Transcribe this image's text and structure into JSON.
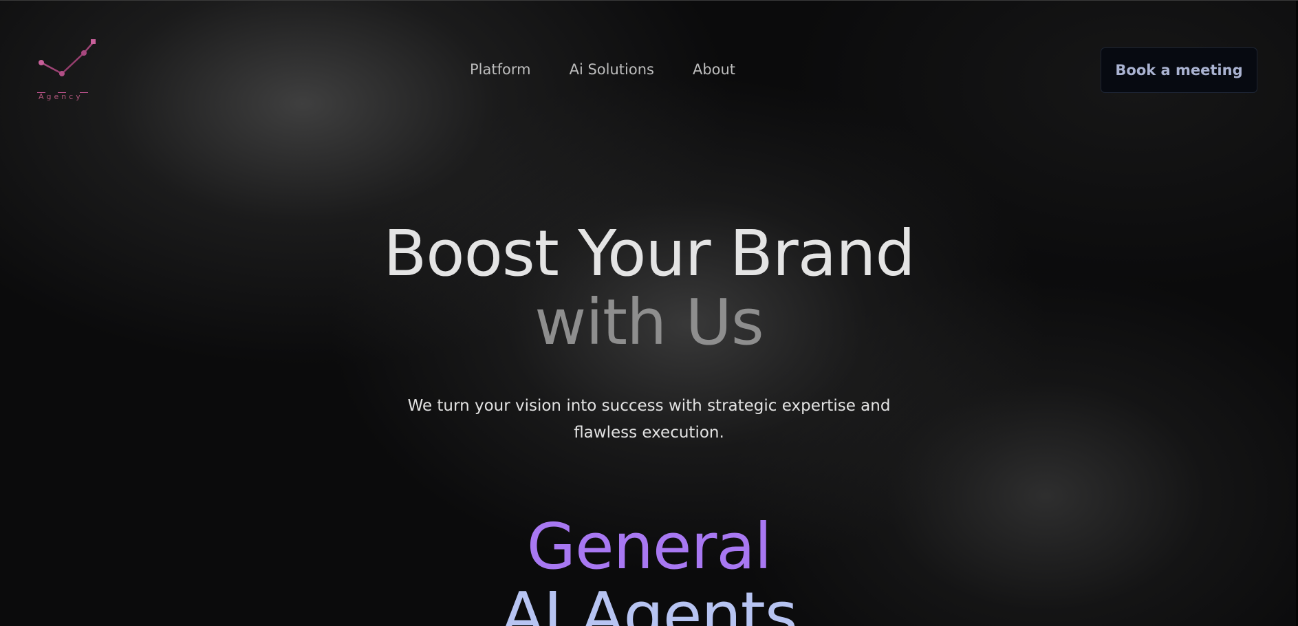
{
  "brand": {
    "logo_icon": "m-growth-chart-logo-icon",
    "logo_text": "Agency",
    "logo_color": "#c05a87"
  },
  "nav": {
    "items": [
      {
        "label": "Platform"
      },
      {
        "label": "Ai Solutions"
      },
      {
        "label": "About"
      }
    ]
  },
  "cta": {
    "label": "Book a meeting"
  },
  "hero": {
    "title_line1": "Boost Your Brand",
    "title_line2": "with Us",
    "subtitle_line1": "We turn your vision into success with strategic expertise and",
    "subtitle_line2": "flawless execution."
  },
  "agents": {
    "title_line1": "General",
    "title_line2": "AI Agents",
    "accent_color": "#a878f2",
    "secondary_color": "#b7c4f2"
  }
}
